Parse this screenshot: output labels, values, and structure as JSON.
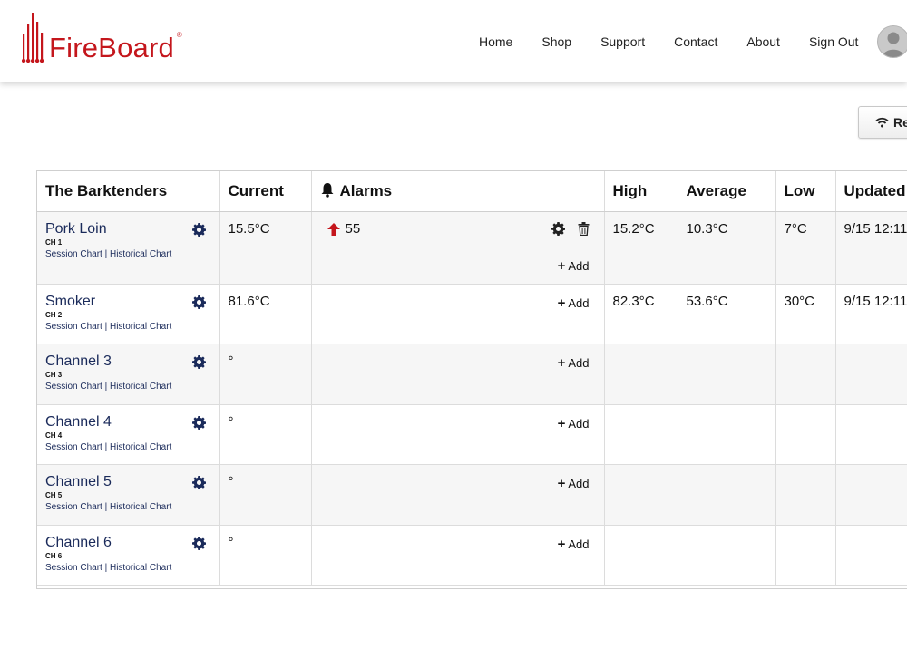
{
  "brand": {
    "name": "FireBoard",
    "reg": "®",
    "color": "#c4161c"
  },
  "nav": {
    "items": [
      "Home",
      "Shop",
      "Support",
      "Contact",
      "About",
      "Sign Out"
    ]
  },
  "refresh": {
    "label": "Re",
    "icon": "wifi-icon"
  },
  "table": {
    "headers": {
      "device": "The Barktenders",
      "current": "Current",
      "alarms": "Alarms",
      "high": "High",
      "average": "Average",
      "low": "Low",
      "updated": "Updated"
    },
    "add_label": "Add",
    "session_link": "Session Chart",
    "link_sep": " | ",
    "historical_link": "Historical Chart",
    "rows": [
      {
        "name": "Pork Loin",
        "ch": "CH 1",
        "current": "15.5°C",
        "alarm": "55",
        "high": "15.2°C",
        "average": "10.3°C",
        "low": "7°C",
        "updated": "9/15 12:11"
      },
      {
        "name": "Smoker",
        "ch": "CH 2",
        "current": "81.6°C",
        "alarm": "",
        "high": "82.3°C",
        "average": "53.6°C",
        "low": "30°C",
        "updated": "9/15 12:11"
      },
      {
        "name": "Channel 3",
        "ch": "CH 3",
        "current": "°",
        "alarm": "",
        "high": "",
        "average": "",
        "low": "",
        "updated": ""
      },
      {
        "name": "Channel 4",
        "ch": "CH 4",
        "current": "°",
        "alarm": "",
        "high": "",
        "average": "",
        "low": "",
        "updated": ""
      },
      {
        "name": "Channel 5",
        "ch": "CH 5",
        "current": "°",
        "alarm": "",
        "high": "",
        "average": "",
        "low": "",
        "updated": ""
      },
      {
        "name": "Channel 6",
        "ch": "CH 6",
        "current": "°",
        "alarm": "",
        "high": "",
        "average": "",
        "low": "",
        "updated": ""
      }
    ]
  }
}
